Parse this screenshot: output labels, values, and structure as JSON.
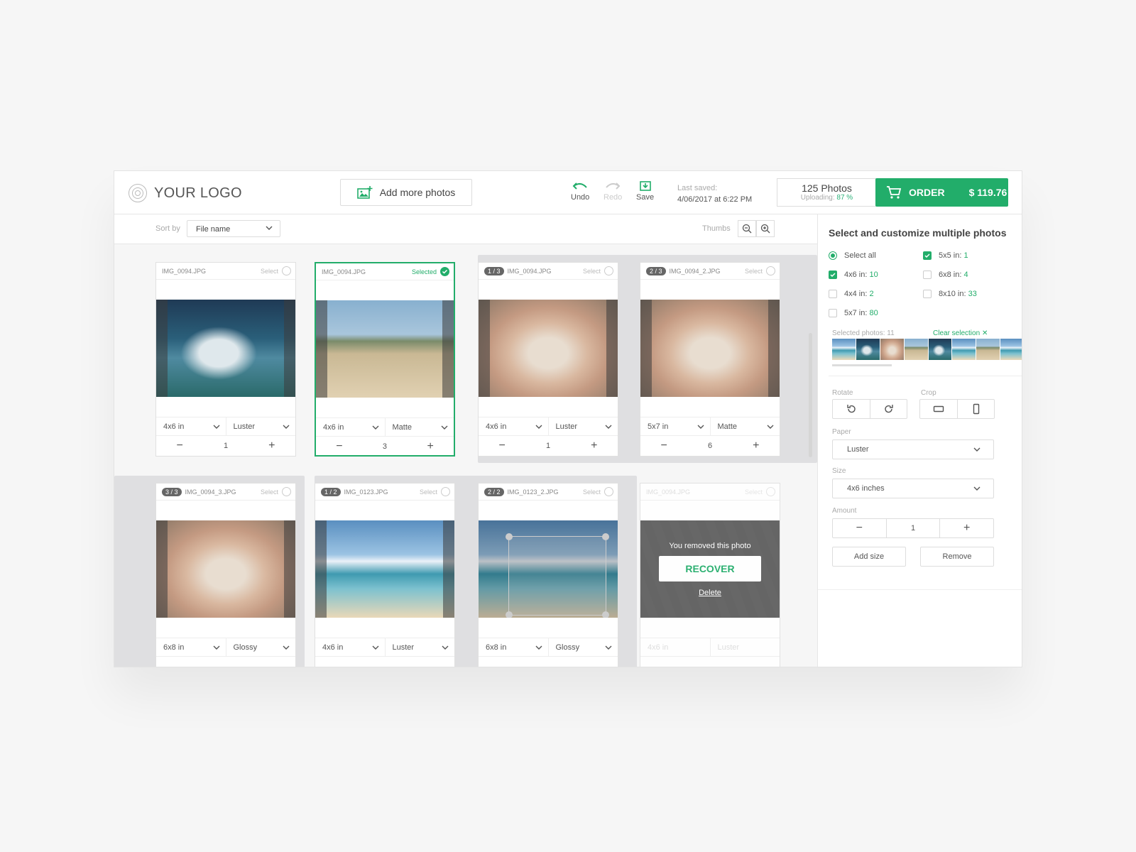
{
  "header": {
    "logo_text": "YOUR LOGO",
    "add_photos_label": "Add more photos",
    "undo_label": "Undo",
    "redo_label": "Redo",
    "save_label": "Save",
    "last_saved_label": "Last saved:",
    "last_saved_value": "4/06/2017 at 6:22 PM",
    "photos_count": "125 Photos",
    "uploading_label": "Uploading:",
    "uploading_value": "87 %",
    "order_label": "ORDER",
    "order_price": "$ 119.76"
  },
  "toolbar": {
    "sort_label": "Sort by",
    "sort_value": "File name",
    "thumbs_label": "Thumbs"
  },
  "cards": [
    {
      "file": "IMG_0094.JPG",
      "badge": "",
      "select": "Select",
      "size": "4x6 in",
      "paper": "Luster",
      "qty": "1"
    },
    {
      "file": "IMG_0094.JPG",
      "badge": "",
      "select": "Selected",
      "size": "4x6 in",
      "paper": "Matte",
      "qty": "3"
    },
    {
      "file": "IMG_0094.JPG",
      "badge": "1 / 3",
      "select": "Select",
      "size": "4x6 in",
      "paper": "Luster",
      "qty": "1"
    },
    {
      "file": "IMG_0094_2.JPG",
      "badge": "2 / 3",
      "select": "Select",
      "size": "5x7 in",
      "paper": "Matte",
      "qty": "6"
    },
    {
      "file": "IMG_0094_3.JPG",
      "badge": "3 / 3",
      "select": "Select",
      "size": "6x8 in",
      "paper": "Glossy",
      "qty": ""
    },
    {
      "file": "IMG_0123.JPG",
      "badge": "1 / 2",
      "select": "Select",
      "size": "4x6 in",
      "paper": "Luster",
      "qty": ""
    },
    {
      "file": "IMG_0123_2.JPG",
      "badge": "2 / 2",
      "select": "Select",
      "size": "6x8 in",
      "paper": "Glossy",
      "qty": ""
    },
    {
      "file": "IMG_0094.JPG",
      "badge": "",
      "select": "Select",
      "size": "4x6 in",
      "paper": "Luster",
      "qty": ""
    }
  ],
  "removed": {
    "message": "You removed this photo",
    "recover_label": "RECOVER",
    "delete_label": "Delete"
  },
  "side": {
    "title": "Select and customize multiple photos",
    "select_all": "Select all",
    "filters": [
      {
        "label": "5x5 in:",
        "count": "1"
      },
      {
        "label": "4x6 in:",
        "count": "10"
      },
      {
        "label": "6x8 in:",
        "count": "4"
      },
      {
        "label": "4x4 in:",
        "count": "2"
      },
      {
        "label": "8x10 in:",
        "count": "33"
      },
      {
        "label": "5x7 in:",
        "count": "80"
      }
    ],
    "selected_label": "Selected photos: 11",
    "clear_label": "Clear selection",
    "rotate_label": "Rotate",
    "crop_label": "Crop",
    "paper_label": "Paper",
    "paper_value": "Luster",
    "size_label": "Size",
    "size_value": "4x6 inches",
    "amount_label": "Amount",
    "amount_value": "1",
    "add_size_label": "Add size",
    "remove_label": "Remove"
  },
  "colors": {
    "accent": "#22ad6a",
    "group_bg": "#dfdfe1"
  }
}
